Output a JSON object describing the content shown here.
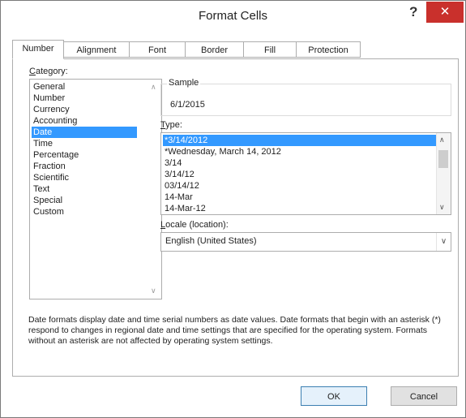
{
  "window": {
    "title": "Format Cells",
    "help": "?",
    "close": "✕"
  },
  "tabs": [
    "Number",
    "Alignment",
    "Font",
    "Border",
    "Fill",
    "Protection"
  ],
  "category": {
    "label_u": "C",
    "label_rest": "ategory:",
    "items": [
      "General",
      "Number",
      "Currency",
      "Accounting",
      "Date",
      "Time",
      "Percentage",
      "Fraction",
      "Scientific",
      "Text",
      "Special",
      "Custom"
    ],
    "selected": "Date"
  },
  "sample": {
    "label": "Sample",
    "value": "6/1/2015"
  },
  "type": {
    "label_u": "T",
    "label_rest": "ype:",
    "items": [
      "*3/14/2012",
      "*Wednesday, March 14, 2012",
      "3/14",
      "3/14/12",
      "03/14/12",
      "14-Mar",
      "14-Mar-12"
    ],
    "selected": "*3/14/2012"
  },
  "locale": {
    "label_u": "L",
    "label_rest": "ocale (location):",
    "value": "English (United States)"
  },
  "description": "Date formats display date and time serial numbers as date values.  Date formats that begin with an asterisk (*) respond to changes in regional date and time settings that are specified for the operating system. Formats without an asterisk are not affected by operating system settings.",
  "buttons": {
    "ok": "OK",
    "cancel": "Cancel"
  },
  "icons": {
    "scroll_up": "∧",
    "scroll_down": "∨",
    "dropdown": "∨"
  }
}
